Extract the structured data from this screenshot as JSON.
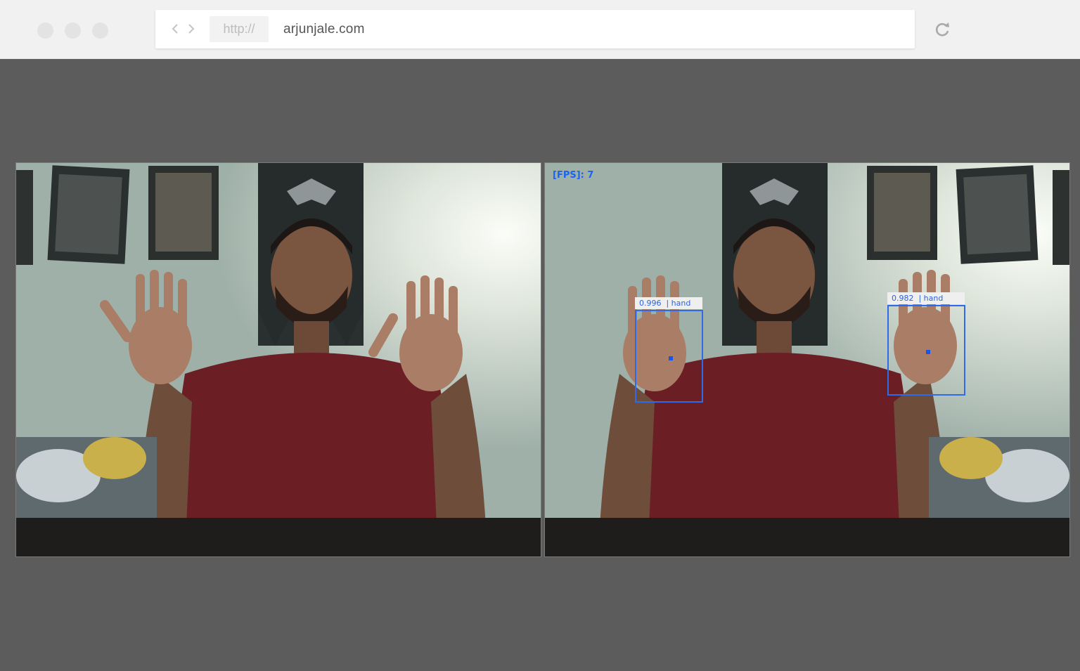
{
  "browser": {
    "protocol": "http://",
    "url": "arjunjale.com",
    "back_icon": "chevron-left-icon",
    "forward_icon": "chevron-right-icon",
    "reload_icon": "reload-icon"
  },
  "right_panel": {
    "fps_text": "[FPS]: 7",
    "detections": [
      {
        "score": "0.996",
        "label_text": "0.996  | hand"
      },
      {
        "score": "0.982",
        "label_text": "0.982  | hand"
      }
    ],
    "accent_color": "#2f6be8"
  }
}
